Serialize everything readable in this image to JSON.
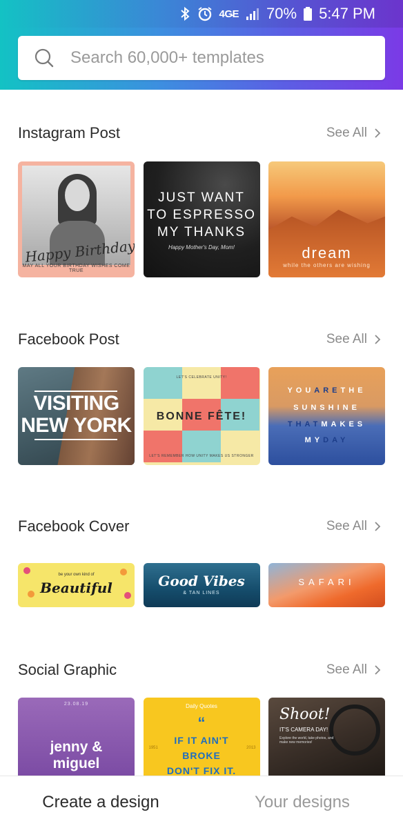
{
  "status_bar": {
    "network": "4G̵E",
    "battery": "70%",
    "time": "5:47 PM",
    "icons": [
      "bluetooth-icon",
      "alarm-icon",
      "network-icon",
      "signal-icon",
      "battery-icon"
    ]
  },
  "search": {
    "placeholder": "Search 60,000+ templates",
    "value": ""
  },
  "sections": [
    {
      "title": "Instagram Post",
      "see_all": "See All",
      "cards": [
        {
          "text": "Happy Birthday!",
          "sub": "MAY ALL YOUR BIRTHDAY WISHES COME TRUE"
        },
        {
          "lines": [
            "JUST WANT",
            "TO ESPRESSO",
            "MY THANKS"
          ],
          "sub": "Happy Mother's Day, Mom!"
        },
        {
          "text": "dream",
          "sub": "while the others are wishing"
        }
      ]
    },
    {
      "title": "Facebook Post",
      "see_all": "See All",
      "cards": [
        {
          "lines": [
            "VISITING",
            "NEW YORK"
          ]
        },
        {
          "text": "BONNE FÊTE!",
          "top": "LET'S CELEBRATE UNITY!",
          "bottom": "LET'S REMEMBER HOW UNITY MAKES US STRONGER"
        },
        {
          "rows": [
            {
              "a": "YOU",
              "b": "ARE",
              "c": "THE"
            },
            {
              "a": "SUNSHINE",
              "b": "",
              "c": ""
            },
            {
              "a": "",
              "b": "THAT",
              "c": "MAKES"
            },
            {
              "a": "MY",
              "b": "DAY",
              "c": ""
            }
          ]
        }
      ]
    },
    {
      "title": "Facebook Cover",
      "see_all": "See All",
      "cards": [
        {
          "text": "Beautiful",
          "sub": "be your own kind of"
        },
        {
          "text": "Good Vibes",
          "sub": "& TAN LINES"
        },
        {
          "text": "SAFARI"
        }
      ]
    },
    {
      "title": "Social Graphic",
      "see_all": "See All",
      "cards": [
        {
          "date": "23.08.19",
          "lines": [
            "jenny &",
            "miguel"
          ]
        },
        {
          "header": "Daily Quotes",
          "quote": "“",
          "lines": [
            "IF IT AIN'T",
            "BROKE",
            "DON'T FIX IT."
          ],
          "year_left": "1951",
          "year_right": "2013"
        },
        {
          "text": "Shoot!",
          "sub": "IT'S CAMERA DAY!",
          "sub2": "Explore the world, take photos, and make new memories!"
        }
      ]
    }
  ],
  "bottom_nav": {
    "create": "Create a design",
    "yours": "Your designs"
  },
  "colors": {
    "header_gradient_start": "#13c2c4",
    "header_gradient_end": "#7b3ae6",
    "title_text": "#2b2b2b",
    "muted_text": "#8a8a8a"
  }
}
